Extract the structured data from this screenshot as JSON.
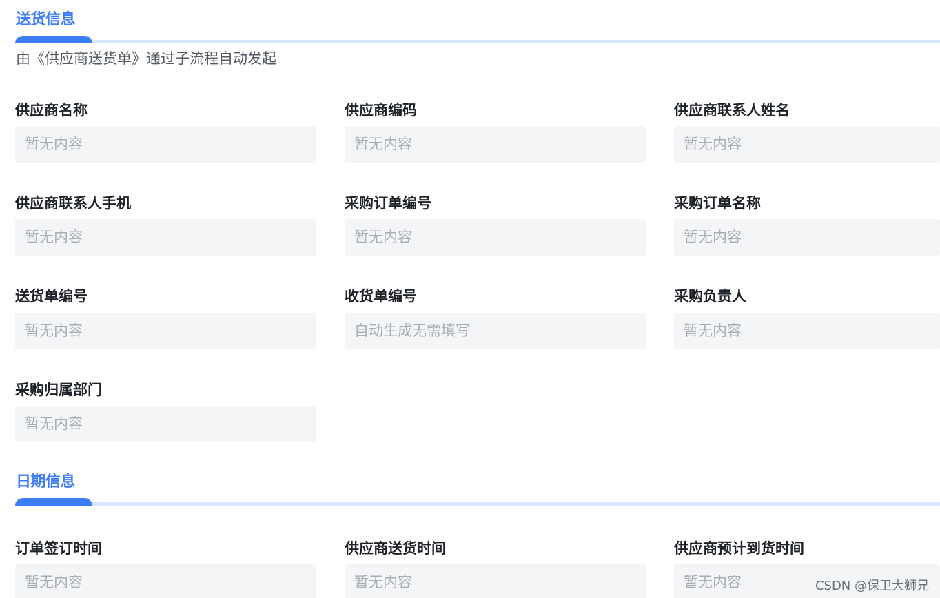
{
  "delivery_section": {
    "title": "送货信息",
    "description": "由《供应商送货单》通过子流程自动发起",
    "fields": [
      {
        "label": "供应商名称",
        "value": "暂无内容"
      },
      {
        "label": "供应商编码",
        "value": "暂无内容"
      },
      {
        "label": "供应商联系人姓名",
        "value": "暂无内容"
      },
      {
        "label": "供应商联系人手机",
        "value": "暂无内容"
      },
      {
        "label": "采购订单编号",
        "value": "暂无内容"
      },
      {
        "label": "采购订单名称",
        "value": "暂无内容"
      },
      {
        "label": "送货单编号",
        "value": "暂无内容"
      },
      {
        "label": "收货单编号",
        "value": "自动生成无需填写"
      },
      {
        "label": "采购负责人",
        "value": "暂无内容"
      },
      {
        "label": "采购归属部门",
        "value": "暂无内容"
      }
    ]
  },
  "date_section": {
    "title": "日期信息",
    "fields": [
      {
        "label": "订单签订时间",
        "value": "暂无内容"
      },
      {
        "label": "供应商送货时间",
        "value": "暂无内容"
      },
      {
        "label": "供应商预计到货时间",
        "value": "暂无内容"
      }
    ]
  },
  "watermark": "CSDN @保卫大狮兄",
  "colors": {
    "accent": "#3d7df6",
    "accent_light": "#d7e5fd",
    "field_background": "#f4f5f7",
    "placeholder_text": "#a9adb4",
    "label_text": "#1f2329"
  }
}
